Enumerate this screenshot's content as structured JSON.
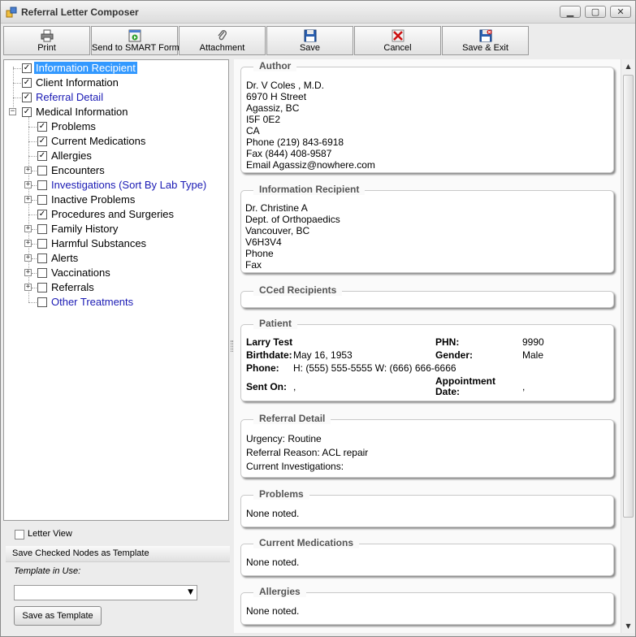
{
  "window": {
    "title": "Referral Letter Composer",
    "controls": [
      "▁",
      "▢",
      "✕"
    ]
  },
  "toolbar": {
    "buttons": [
      {
        "label": "Print",
        "icon": "printer-icon"
      },
      {
        "label": "Send to SMART Form",
        "icon": "smart-form-icon"
      },
      {
        "label": "Attachment",
        "icon": "paperclip-icon"
      },
      {
        "label": "Save",
        "icon": "floppy-disk-icon"
      },
      {
        "label": "Cancel",
        "icon": "cancel-icon"
      },
      {
        "label": "Save & Exit",
        "icon": "save-exit-icon"
      }
    ]
  },
  "tree": {
    "nodes": [
      {
        "label": "Information Recipient",
        "checked": true,
        "selected": true,
        "link": false
      },
      {
        "label": "Client Information",
        "checked": true,
        "selected": false,
        "link": false
      },
      {
        "label": "Referral Detail",
        "checked": true,
        "selected": false,
        "link": true
      },
      {
        "label": "Medical Information",
        "checked": true,
        "selected": false,
        "link": false,
        "expander": "−"
      },
      {
        "label": "Problems",
        "checked": true,
        "link": false
      },
      {
        "label": "Current Medications",
        "checked": true,
        "link": false
      },
      {
        "label": "Allergies",
        "checked": true,
        "link": false
      },
      {
        "label": "Encounters",
        "checked": false,
        "link": false,
        "expander": "+"
      },
      {
        "label": "Investigations (Sort By Lab Type)",
        "checked": false,
        "link": true,
        "expander": "+"
      },
      {
        "label": "Inactive Problems",
        "checked": false,
        "link": false,
        "expander": "+"
      },
      {
        "label": "Procedures and Surgeries",
        "checked": true,
        "link": false
      },
      {
        "label": "Family History",
        "checked": false,
        "link": false,
        "expander": "+"
      },
      {
        "label": "Harmful Substances",
        "checked": false,
        "link": false,
        "expander": "+"
      },
      {
        "label": "Alerts",
        "checked": false,
        "link": false,
        "expander": "+"
      },
      {
        "label": "Vaccinations",
        "checked": false,
        "link": false,
        "expander": "+"
      },
      {
        "label": "Referrals",
        "checked": false,
        "link": false,
        "expander": "+"
      },
      {
        "label": "Other Treatments",
        "checked": false,
        "link": true
      }
    ]
  },
  "letter_view": {
    "label": "Letter View",
    "checked": false
  },
  "template": {
    "header": "Save Checked Nodes as Template",
    "in_use_label": "Template in Use:",
    "selected_value": "",
    "save_button": "Save as Template"
  },
  "sections": {
    "author": {
      "title": "Author",
      "lines": [
        "Dr. V Coles , M.D.",
        "6970 H Street",
        "Agassiz, BC",
        "I5F 0E2",
        "CA",
        "Phone (219) 843-6918",
        "Fax (844) 408-9587",
        "Email Agassiz@nowhere.com"
      ]
    },
    "recipient": {
      "title": "Information Recipient",
      "lines": [
        "Dr. Christine A",
        "Dept. of Orthopaedics",
        "Vancouver, BC",
        "V6H3V4",
        "Phone",
        "Fax"
      ]
    },
    "cced": {
      "title": "CCed Recipients"
    },
    "patient": {
      "title": "Patient",
      "name": "Larry Test",
      "birthdate_label": "Birthdate:",
      "birthdate": "May 16, 1953",
      "phone_label": "Phone:",
      "phone": "H: (555) 555-5555 W: (666) 666-6666",
      "sent_on_label": "Sent On:",
      "sent_on": ",",
      "phn_label": "PHN:",
      "phn": "9990",
      "gender_label": "Gender:",
      "gender": "Male",
      "appointment_label_1": "Appointment",
      "appointment_label_2": "Date:",
      "appointment": ","
    },
    "referral": {
      "title": "Referral Detail",
      "lines": [
        "Urgency: Routine",
        "Referral Reason: ACL repair",
        "Current Investigations:"
      ]
    },
    "problems": {
      "title": "Problems",
      "text": "None noted."
    },
    "medications": {
      "title": "Current Medications",
      "text": "None noted."
    },
    "allergies": {
      "title": "Allergies",
      "text": "None noted."
    }
  },
  "colors": {
    "selection": "#3399ff",
    "link_text": "#1a1ab4",
    "cancel_red": "#cc1111",
    "save_blue": "#2a5fb0"
  }
}
